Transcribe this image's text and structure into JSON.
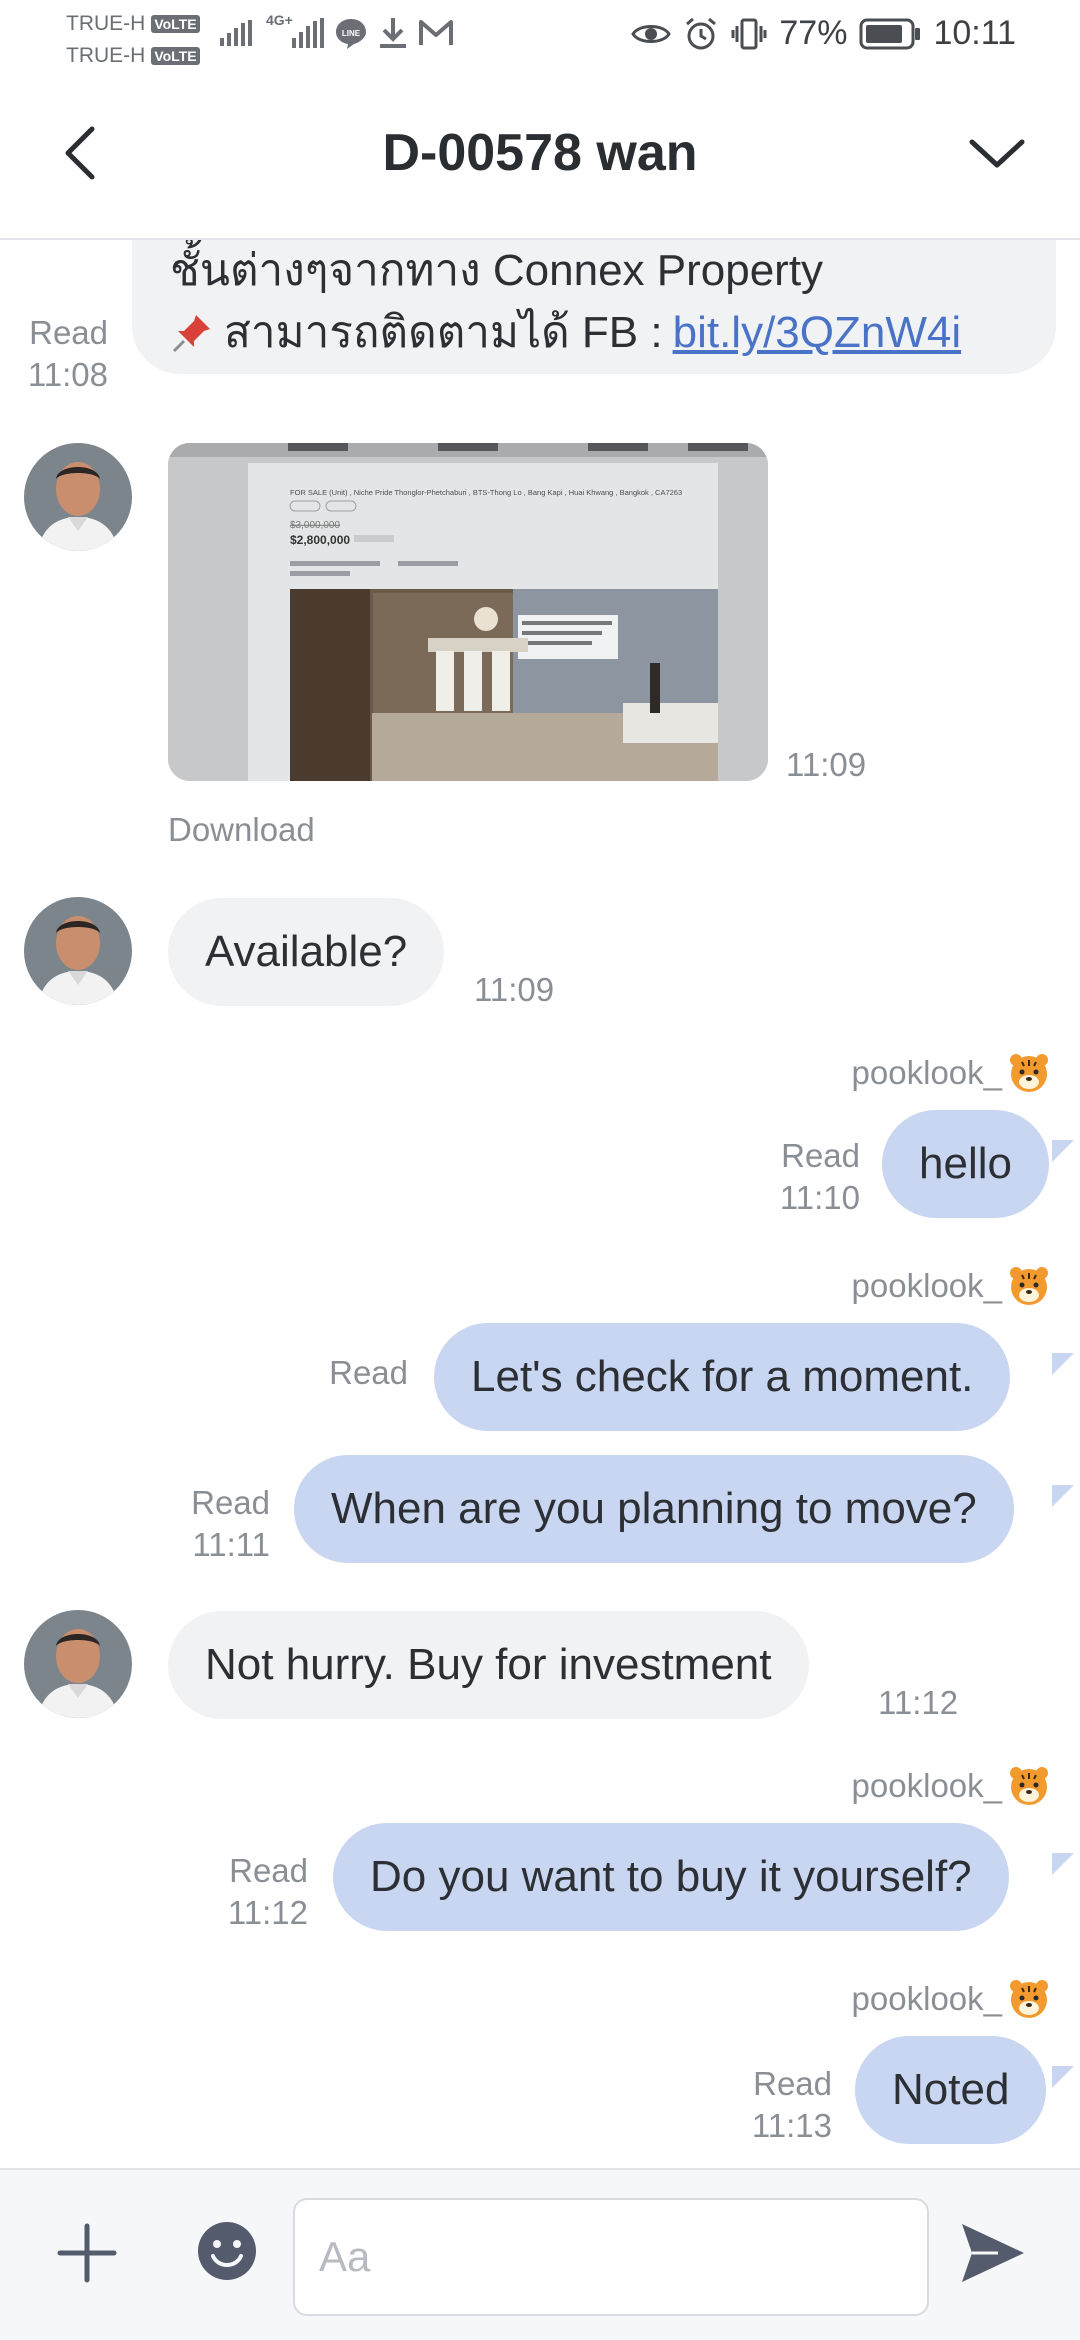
{
  "status_bar": {
    "carrier1": "TRUE-H",
    "carrier2": "TRUE-H",
    "volte_label": "VoLTE",
    "network_label": "4G+",
    "battery": "77%",
    "time": "10:11",
    "icons": [
      "signal-icon",
      "line-app-icon",
      "download-icon",
      "gmail-icon",
      "eye-icon",
      "alarm-icon",
      "vibrate-icon",
      "battery-icon"
    ]
  },
  "header": {
    "title": "D-00578 wan"
  },
  "messages": [
    {
      "side": "in",
      "line1": "ชั้นต่างๆจากทาง Connex Property",
      "line2_text": "สามารถติดตามได้ FB : ",
      "link": "bit.ly/3QZnW4i",
      "meta_read": "Read",
      "meta_time": "11:08"
    },
    {
      "side": "in",
      "type": "image",
      "image_text": {
        "listing": "FOR SALE (Unit) , Niche Pride Thonglor-Phetchaburi , BTS-Thong Lo , Bang Kapi , Huai Khwang , Bangkok , CA7263",
        "old_price": "$3,000,000",
        "price": "$2,800,000"
      },
      "time": "11:09",
      "download_label": "Download"
    },
    {
      "side": "in",
      "text": "Available?",
      "time": "11:09"
    },
    {
      "side": "out",
      "sender": "pooklook_",
      "text": "hello",
      "meta_read": "Read",
      "meta_time": "11:10"
    },
    {
      "side": "out",
      "sender": "pooklook_",
      "text": "Let's check for a moment.",
      "meta_read": "Read"
    },
    {
      "side": "out",
      "text": "When are you planning to move?",
      "meta_read": "Read",
      "meta_time": "11:11"
    },
    {
      "side": "in",
      "text": "Not hurry. Buy for investment",
      "time": "11:12"
    },
    {
      "side": "out",
      "sender": "pooklook_",
      "text": "Do you want to buy it yourself?",
      "meta_read": "Read",
      "meta_time": "11:12"
    },
    {
      "side": "out",
      "sender": "pooklook_",
      "text": "Noted",
      "meta_read": "Read",
      "meta_time": "11:13"
    }
  ],
  "input": {
    "placeholder": "Aa"
  },
  "colors": {
    "incoming_bubble": "#f1f2f4",
    "outgoing_bubble": "#c9d6f1",
    "link": "#4a73c8",
    "meta_text": "#8a8f96"
  }
}
